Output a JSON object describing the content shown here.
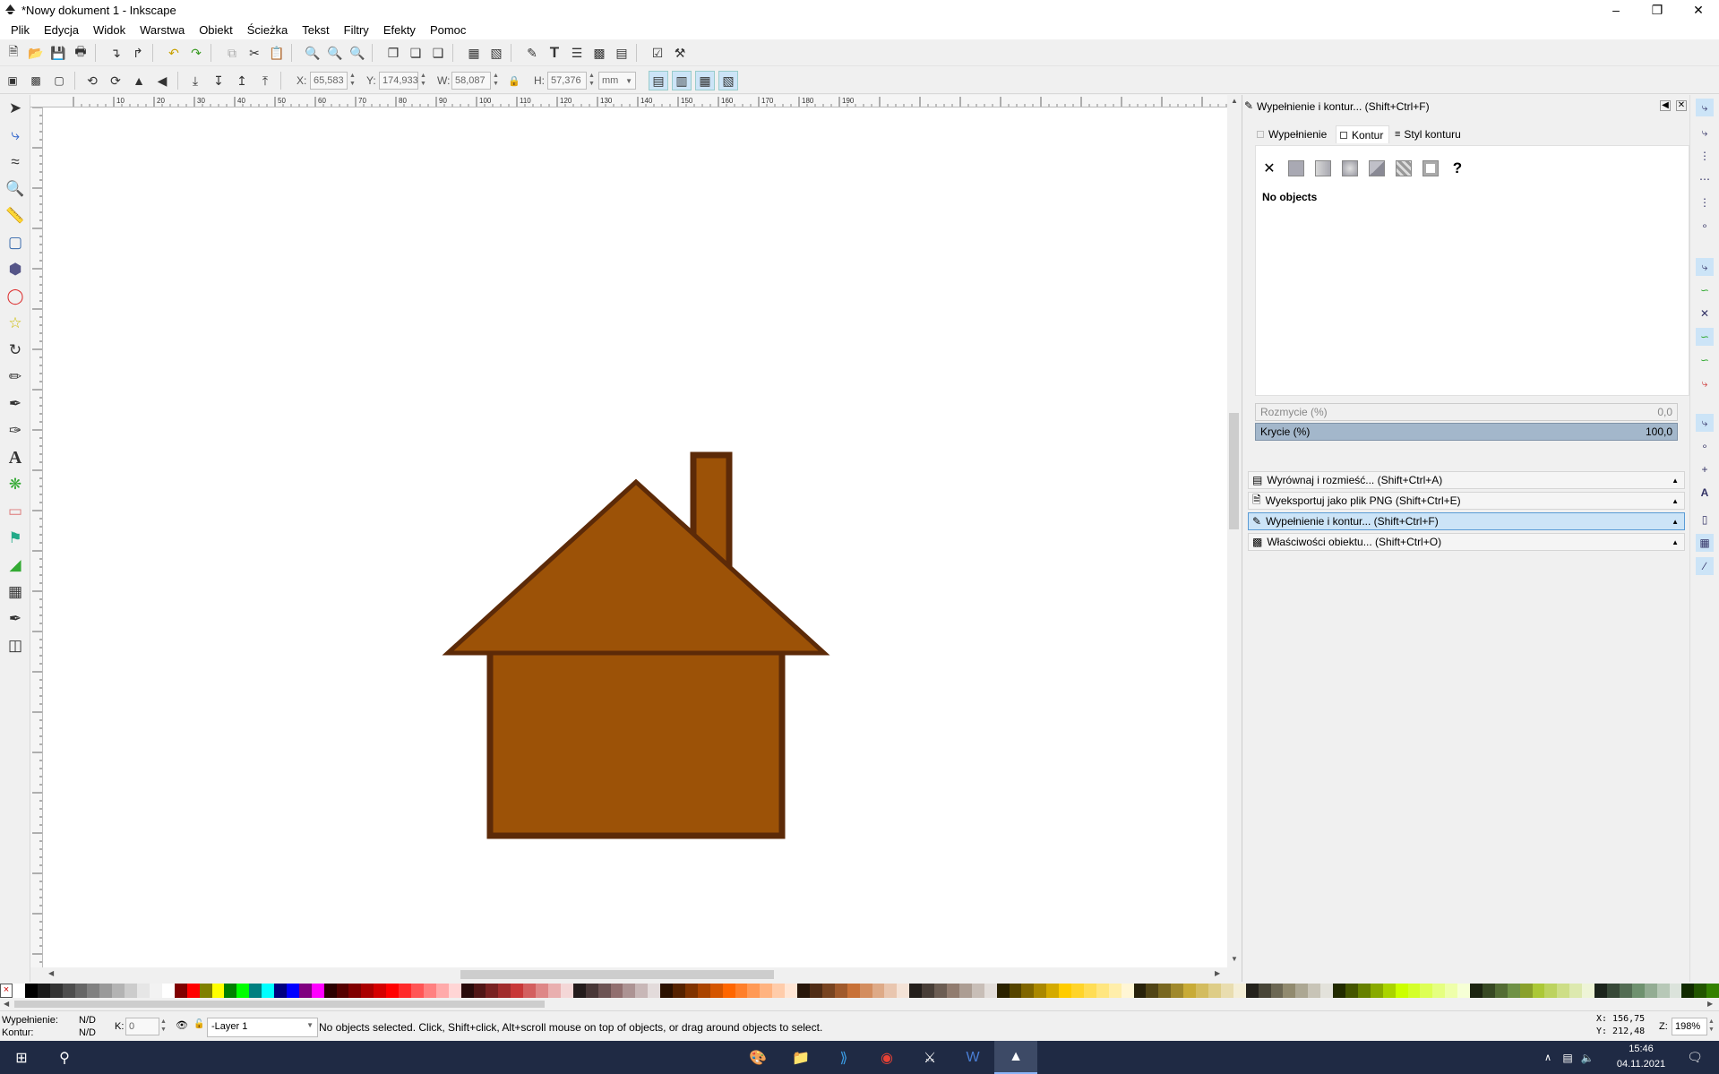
{
  "window": {
    "title": "*Nowy dokument 1 - Inkscape"
  },
  "menu": [
    "Plik",
    "Edycja",
    "Widok",
    "Warstwa",
    "Obiekt",
    "Ścieżka",
    "Tekst",
    "Filtry",
    "Efekty",
    "Pomoc"
  ],
  "toolbar2": {
    "x_label": "X:",
    "x_value": "65,583",
    "y_label": "Y:",
    "y_value": "174,933",
    "w_label": "W:",
    "w_value": "58,087",
    "h_label": "H:",
    "h_value": "57,376",
    "unit": "mm"
  },
  "ruler": {
    "labels": [
      "10",
      "20",
      "30",
      "40",
      "50",
      "60",
      "70",
      "80",
      "90",
      "100",
      "110",
      "120",
      "130",
      "140",
      "150",
      "160",
      "170",
      "180",
      "190"
    ]
  },
  "dock": {
    "header": "Wypełnienie i kontur... (Shift+Ctrl+F)",
    "tabs": [
      "Wypełnienie",
      "Kontur",
      "Styl konturu"
    ],
    "unknown_glyph": "?",
    "no_objects": "No objects",
    "blur_label": "Rozmycie (%)",
    "blur_value": "0,0",
    "opacity_label": "Krycie (%)",
    "opacity_value": "100,0",
    "items": [
      "Wyrównaj i rozmieść... (Shift+Ctrl+A)",
      "Wyeksportuj jako plik PNG (Shift+Ctrl+E)",
      "Wypełnienie i kontur... (Shift+Ctrl+F)",
      "Właściwości obiektu... (Shift+Ctrl+O)"
    ]
  },
  "status": {
    "fill_label": "Wypełnienie:",
    "fill_value": "N/D",
    "stroke_label": "Kontur:",
    "stroke_value": "N/D",
    "k_label": "K:",
    "k_value": "0",
    "layer": "-Layer 1",
    "message": "No objects selected. Click, Shift+click, Alt+scroll mouse on top of objects, or drag around objects to select.",
    "cursor_x": "X: 156,75",
    "cursor_y": "Y: 212,48",
    "zoom_label": "Z:",
    "zoom_value": "198%"
  },
  "taskbar": {
    "time": "15:46",
    "date": "04.11.2021"
  },
  "colors": {
    "house_fill": "#9c5207",
    "house_stroke": "#5c2a08",
    "accent": "#cce4f7"
  }
}
